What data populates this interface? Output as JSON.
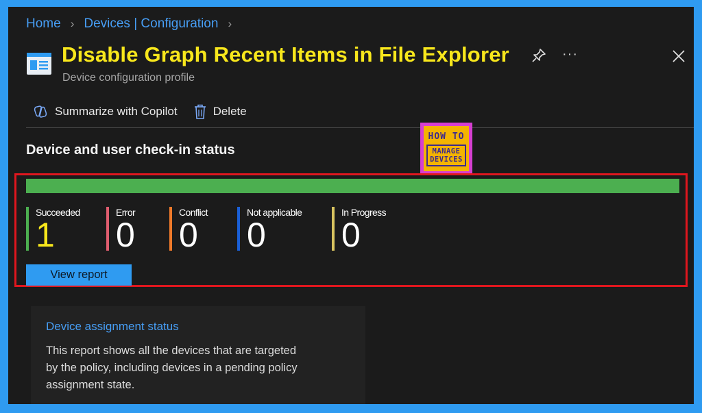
{
  "breadcrumb": [
    "Home",
    "Devices | Configuration"
  ],
  "header": {
    "title": "Disable Graph Recent Items in File Explorer",
    "subtitle": "Device configuration profile",
    "icons": [
      "profile-icon",
      "pin-icon",
      "more-icon",
      "close-icon"
    ],
    "more_label": "···"
  },
  "toolbar": {
    "copilot_label": "Summarize with Copilot",
    "delete_label": "Delete"
  },
  "section": {
    "title": "Device and user check-in status"
  },
  "logo": {
    "top": "HOW TO",
    "line1": "MANAGE",
    "line2": "DEVICES"
  },
  "progress": {
    "succeeded_fraction": 1.0,
    "color": "#4caf50"
  },
  "stats": [
    {
      "label": "Succeeded",
      "value": "1",
      "color": "#4caf50",
      "value_color": "#f8e71c"
    },
    {
      "label": "Error",
      "value": "0",
      "color": "#e05d6f",
      "value_color": "#ffffff"
    },
    {
      "label": "Conflict",
      "value": "0",
      "color": "#f07a2a",
      "value_color": "#ffffff"
    },
    {
      "label": "Not applicable",
      "value": "0",
      "color": "#1a5fd6",
      "value_color": "#ffffff"
    },
    {
      "label": "In Progress",
      "value": "0",
      "color": "#d9c460",
      "value_color": "#ffffff"
    }
  ],
  "view_report_label": "View report",
  "card": {
    "title": "Device assignment status",
    "description": "This report shows all the devices that are targeted by the policy, including devices in a pending policy assignment state."
  },
  "colors": {
    "accent": "#2f9bf1",
    "title": "#f8e71c",
    "highlight_border": "#e0161e"
  }
}
